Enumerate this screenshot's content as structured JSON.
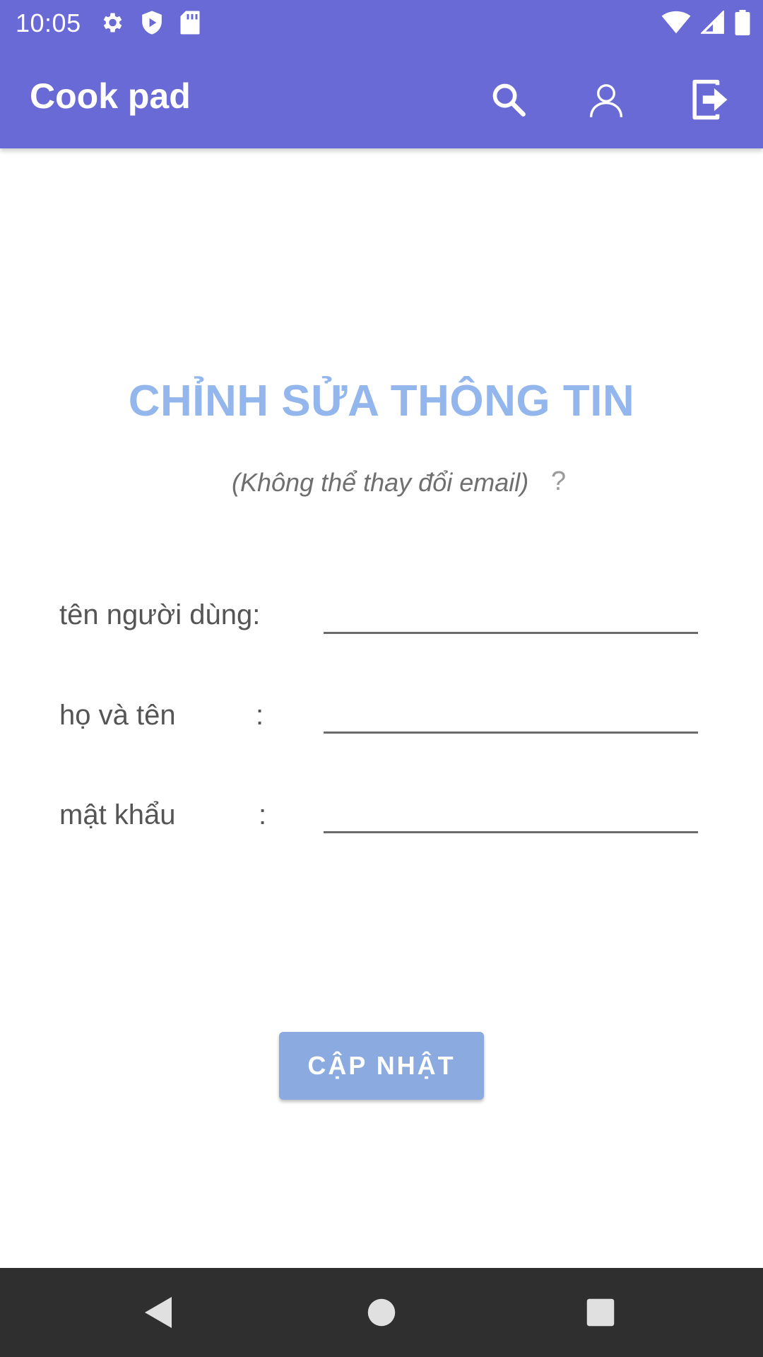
{
  "status_bar": {
    "time": "10:05",
    "left_icons": [
      "settings-icon",
      "shield-play-icon",
      "sd-card-icon"
    ],
    "right_icons": [
      "wifi-icon",
      "cellular-signal-icon",
      "battery-icon"
    ]
  },
  "app_bar": {
    "title": "Cook pad",
    "actions": [
      "search-icon",
      "account-icon",
      "logout-icon"
    ],
    "background_color": "#6A6AD6"
  },
  "form": {
    "title": "CHỈNH SỬA THÔNG TIN",
    "title_color": "#93B6EC",
    "subtitle": "(Không thể thay đổi email)",
    "help_icon": "?",
    "fields": {
      "username": {
        "label": "tên người dùng:",
        "value": ""
      },
      "fullname": {
        "label": "họ và tên",
        "colon": ":",
        "value": ""
      },
      "password": {
        "label": "mật khẩu",
        "colon": ":",
        "value": ""
      }
    },
    "submit_label": "CẬP NHẬT",
    "submit_color": "#8AAAE0"
  },
  "nav_bar": {
    "buttons": [
      "back-icon",
      "home-icon",
      "recent-apps-icon"
    ]
  }
}
